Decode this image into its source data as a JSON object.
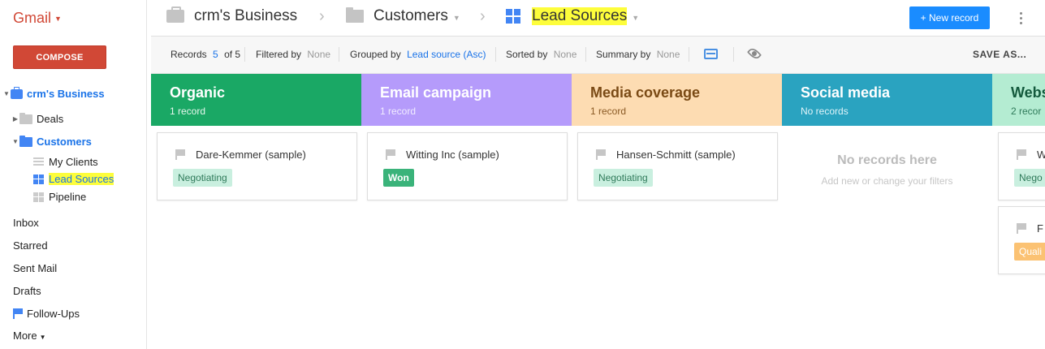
{
  "gmail": {
    "logo": "Gmail",
    "compose": "COMPOSE",
    "business": "crm's Business",
    "tree": {
      "deals": "Deals",
      "customers": "Customers",
      "my_clients": "My Clients",
      "lead_sources": "Lead Sources",
      "pipeline": "Pipeline"
    },
    "nav": {
      "inbox": "Inbox",
      "starred": "Starred",
      "sent": "Sent Mail",
      "drafts": "Drafts",
      "followups": "Follow-Ups",
      "more": "More"
    }
  },
  "header": {
    "crumb_business": "crm's Business",
    "crumb_customers": "Customers",
    "crumb_view": "Lead Sources",
    "new_record": "+ New record"
  },
  "toolbar": {
    "records_label": "Records",
    "records_shown": "5",
    "records_total": "of 5",
    "filtered_label": "Filtered by",
    "filtered_val": "None",
    "grouped_label": "Grouped by",
    "grouped_val": "Lead source (Asc)",
    "sorted_label": "Sorted by",
    "sorted_val": "None",
    "summary_label": "Summary by",
    "summary_val": "None",
    "save_as": "SAVE AS..."
  },
  "columns": [
    {
      "title": "Organic",
      "count": "1 record",
      "bg": "#1aa865",
      "fg": "#ffffff",
      "sub": "#e6f7ee"
    },
    {
      "title": "Email campaign",
      "count": "1 record",
      "bg": "#b59bfb",
      "fg": "#ffffff",
      "sub": "#f1ecff"
    },
    {
      "title": "Media coverage",
      "count": "1 record",
      "bg": "#fddcb2",
      "fg": "#7a4a15",
      "sub": "#8a5a25"
    },
    {
      "title": "Social media",
      "count": "No records",
      "bg": "#2aa3c0",
      "fg": "#ffffff",
      "sub": "#e0f4f9"
    },
    {
      "title": "Webs",
      "count": "2 recor",
      "bg": "#b4ecd2",
      "fg": "#145a3d",
      "sub": "#2f7a5a"
    }
  ],
  "cards": [
    {
      "title": "Dare-Kemmer (sample)",
      "badge": "Negotiating"
    },
    {
      "title": "Witting Inc (sample)",
      "badge": "Won"
    },
    {
      "title": "Hansen-Schmitt (sample)",
      "badge": "Negotiating"
    },
    {
      "title": "W",
      "badge": "Nego"
    },
    {
      "title": "F",
      "badge": "Quali"
    }
  ],
  "empty": {
    "title": "No records here",
    "sub": "Add new or change your filters"
  }
}
